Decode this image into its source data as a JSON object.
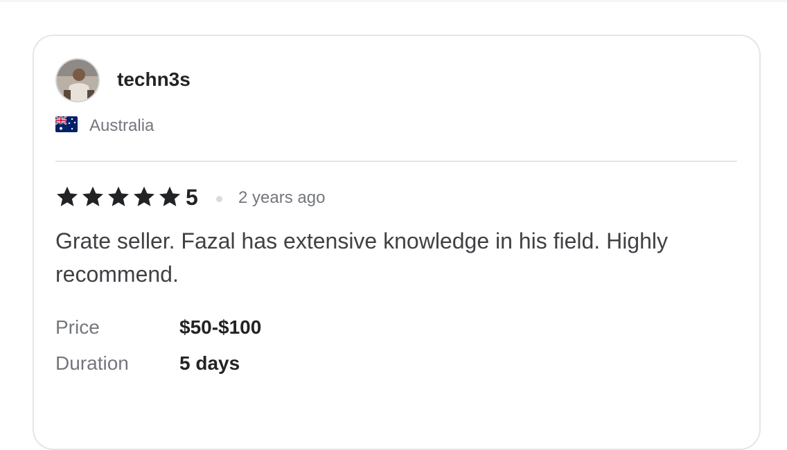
{
  "reviewer": {
    "username": "techn3s",
    "country": "Australia",
    "avatar_icon": "user-avatar-photo",
    "flag_icon": "australia-flag-icon"
  },
  "review": {
    "rating": "5",
    "star_count": 5,
    "star_color": "#222325",
    "time_ago": "2 years ago",
    "text": "Grate seller. Fazal has extensive knowledge in his field. Highly recommend."
  },
  "details": {
    "price_label": "Price",
    "price_value": "$50-$100",
    "duration_label": "Duration",
    "duration_value": "5 days"
  }
}
